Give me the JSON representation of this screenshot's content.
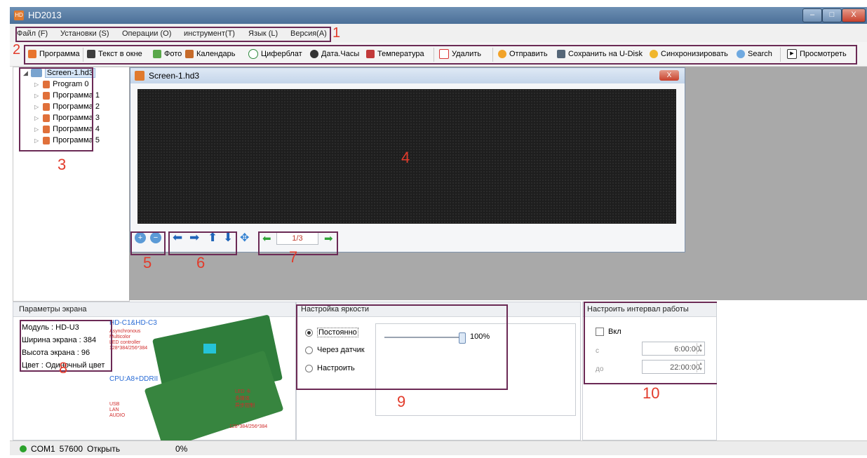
{
  "window": {
    "title": "HD2013",
    "app_icon": "HD",
    "min": "–",
    "max": "□",
    "close": "X"
  },
  "menu": {
    "items": [
      "Файл (F)",
      "Установки (S)",
      "Операции (O)",
      "инструмент(T)",
      "Язык (L)",
      "Версия(A)"
    ]
  },
  "toolbar": {
    "items": [
      {
        "label": "Программа",
        "color": "#e8742e"
      },
      {
        "label": "Текст в окне",
        "color": "#3d3d3d"
      },
      {
        "label": "Фото",
        "color": "#5aa84a"
      },
      {
        "label": "Календарь",
        "color": "#c66b2a"
      },
      {
        "label": "Циферблат",
        "color": "#2f8a3d"
      },
      {
        "label": "Дата.Часы",
        "color": "#333333"
      },
      {
        "label": "Температура",
        "color": "#c23a3a"
      },
      {
        "label": "Удалить",
        "color": "#d93636"
      },
      {
        "label": "Отправить",
        "color": "#f2a329"
      },
      {
        "label": "Сохранить на U-Disk",
        "color": "#556677"
      },
      {
        "label": "Синхронизировать",
        "color": "#f0b62c"
      },
      {
        "label": "Search",
        "color": "#6fa9e0"
      },
      {
        "label": "Просмотреть",
        "color": "#333333"
      }
    ]
  },
  "tree": {
    "root": "Screen-1.hd3",
    "items": [
      "Program 0",
      "Программа 1",
      "Программа 2",
      "Программа 3",
      "Программа 4",
      "Программа 5"
    ]
  },
  "screen_window": {
    "title": "Screen-1.hd3",
    "page_indicator": "1/3"
  },
  "screen_params": {
    "title": "Параметры экрана",
    "module": "Модуль : HD-U3",
    "width": "Ширина экрана : 384",
    "height": "Высота экрана : 96",
    "color": "Цвет : Одиночный цвет",
    "board_text": {
      "model": "HD-C1&HD-C3",
      "async": "Asynchronous",
      "mc": "Multicolor",
      "controller": "LED controller",
      "res": "128*384/256*384",
      "cpu": "CPU:A8+DDRII",
      "usb": "USB",
      "lan": "LAN",
      "audio": "AUDIO",
      "cn1": "LED 卡",
      "cn2": "多媒体",
      "cn3": "异步控制",
      "cn4": "128*384/256*384"
    }
  },
  "brightness": {
    "title": "Настройка яркости",
    "options": [
      "Постоянно",
      "Через датчик",
      "Настроить"
    ],
    "selected": "Постоянно",
    "value_label": "100%",
    "value": 1.0
  },
  "work_interval": {
    "title": "Настроить интервал работы",
    "enable_label": "Вкл",
    "from_label": "с",
    "to_label": "до",
    "from_value": "6:00:00",
    "to_value": "22:00:00"
  },
  "status": {
    "port": "COM1",
    "baud": "57600",
    "state": "Открыть",
    "progress": "0%"
  },
  "annotations": [
    "1",
    "2",
    "3",
    "4",
    "5",
    "6",
    "7",
    "8",
    "9",
    "10"
  ],
  "colors": {
    "annotation": "#e23b2b",
    "box": "#6b2a55",
    "led_bg": "#1e1e1e",
    "title_bar": "#4b6f98"
  }
}
